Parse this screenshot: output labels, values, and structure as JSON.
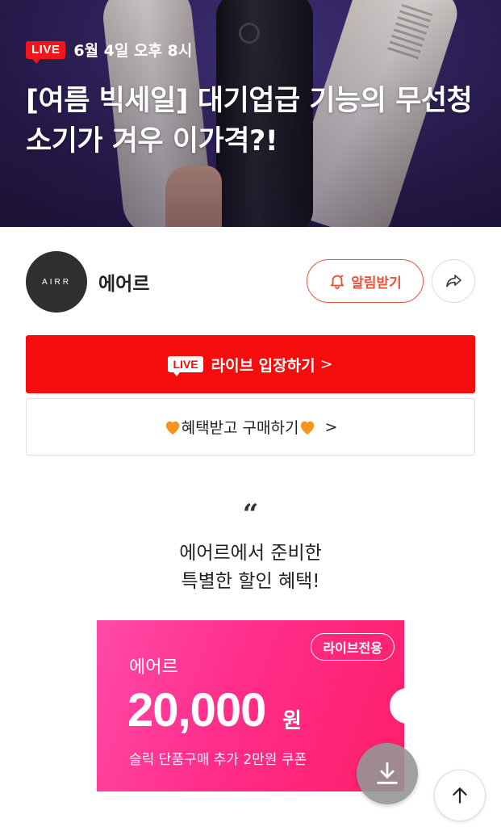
{
  "hero": {
    "live_badge": "LIVE",
    "date": "6월 4일 오후 8시",
    "title": "[여름 빅세일] 대기업급 기능의 무선청소기가 겨우 이가격?!"
  },
  "channel": {
    "avatar_text": "AIRR",
    "name": "에어르",
    "notify_label": "알림받기"
  },
  "actions": {
    "live_badge": "LIVE",
    "live_enter_label": "라이브 입장하기",
    "live_enter_chevron": ">",
    "buy_label": "혜택받고 구매하기",
    "buy_chevron": ">"
  },
  "quote": {
    "mark": "“",
    "line1": "에어르에서 준비한",
    "line2": "특별한 할인 혜택!"
  },
  "coupon": {
    "tag": "라이브전용",
    "brand": "에어르",
    "amount": "20,000",
    "unit": "원",
    "description": "슬릭 단품구매 추가 2만원 쿠폰"
  },
  "colors": {
    "live_red": "#f50c0c",
    "accent_orange": "#e5543a",
    "coupon_pink": "#ff2d8a"
  }
}
